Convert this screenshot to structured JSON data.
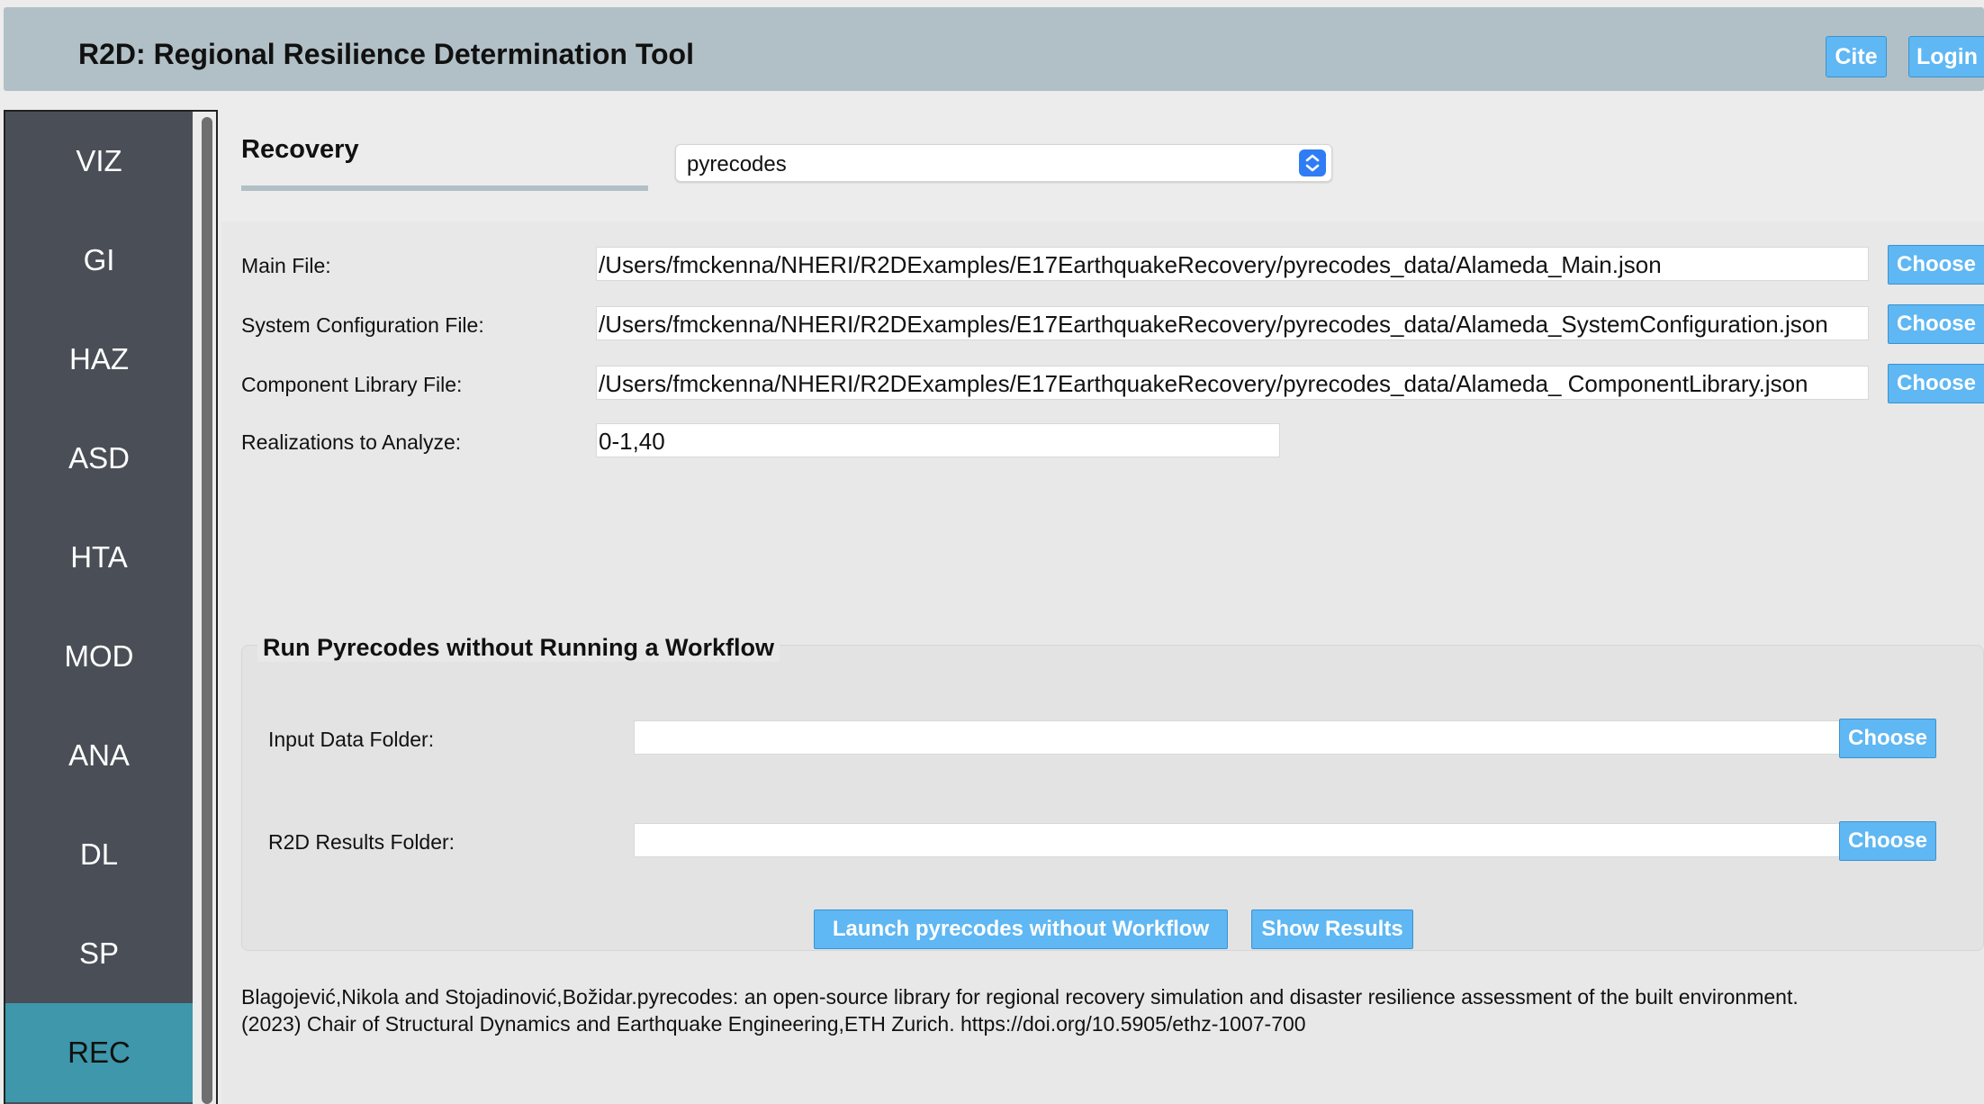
{
  "app": {
    "title": "R2D: Regional Resilience Determination Tool",
    "cite_label": "Cite",
    "login_label": "Login"
  },
  "sidebar": {
    "items": [
      {
        "label": "VIZ"
      },
      {
        "label": "GI"
      },
      {
        "label": "HAZ"
      },
      {
        "label": "ASD"
      },
      {
        "label": "HTA"
      },
      {
        "label": "MOD"
      },
      {
        "label": "ANA"
      },
      {
        "label": "DL"
      },
      {
        "label": "SP"
      },
      {
        "label": "REC",
        "active": true
      }
    ]
  },
  "recovery": {
    "title": "Recovery",
    "method_selected": "pyrecodes",
    "main_file_label": "Main File:",
    "main_file_value": "/Users/fmckenna/NHERI/R2DExamples/E17EarthquakeRecovery/pyrecodes_data/Alameda_Main.json",
    "system_config_label": "System Configuration File:",
    "system_config_value": "/Users/fmckenna/NHERI/R2DExamples/E17EarthquakeRecovery/pyrecodes_data/Alameda_SystemConfiguration.json",
    "component_lib_label": "Component Library File:",
    "component_lib_value": "/Users/fmckenna/NHERI/R2DExamples/E17EarthquakeRecovery/pyrecodes_data/Alameda_ ComponentLibrary.json",
    "realizations_label": "Realizations to Analyze:",
    "realizations_value": "0-1,40",
    "choose_label": "Choose"
  },
  "standalone": {
    "title": "Run Pyrecodes without Running a Workflow",
    "input_folder_label": "Input Data Folder:",
    "input_folder_value": "",
    "results_folder_label": "R2D Results Folder:",
    "results_folder_value": "",
    "choose_label": "Choose",
    "launch_label": "Launch pyrecodes without Workflow",
    "show_results_label": "Show Results"
  },
  "citation": {
    "line1": "Blagojević,Nikola and Stojadinović,Božidar.pyrecodes: an open-source library for regional recovery simulation and disaster resilience assessment of the built environment.",
    "line2": "(2023) Chair of Structural Dynamics and Earthquake Engineering,ETH Zurich. https://doi.org/10.5905/ethz-1007-700"
  },
  "colors": {
    "header_bg": "#b1c0c6",
    "nav_bg": "#4a4f57",
    "nav_active": "#3e97ab",
    "button_bg": "#5fb7f3"
  }
}
